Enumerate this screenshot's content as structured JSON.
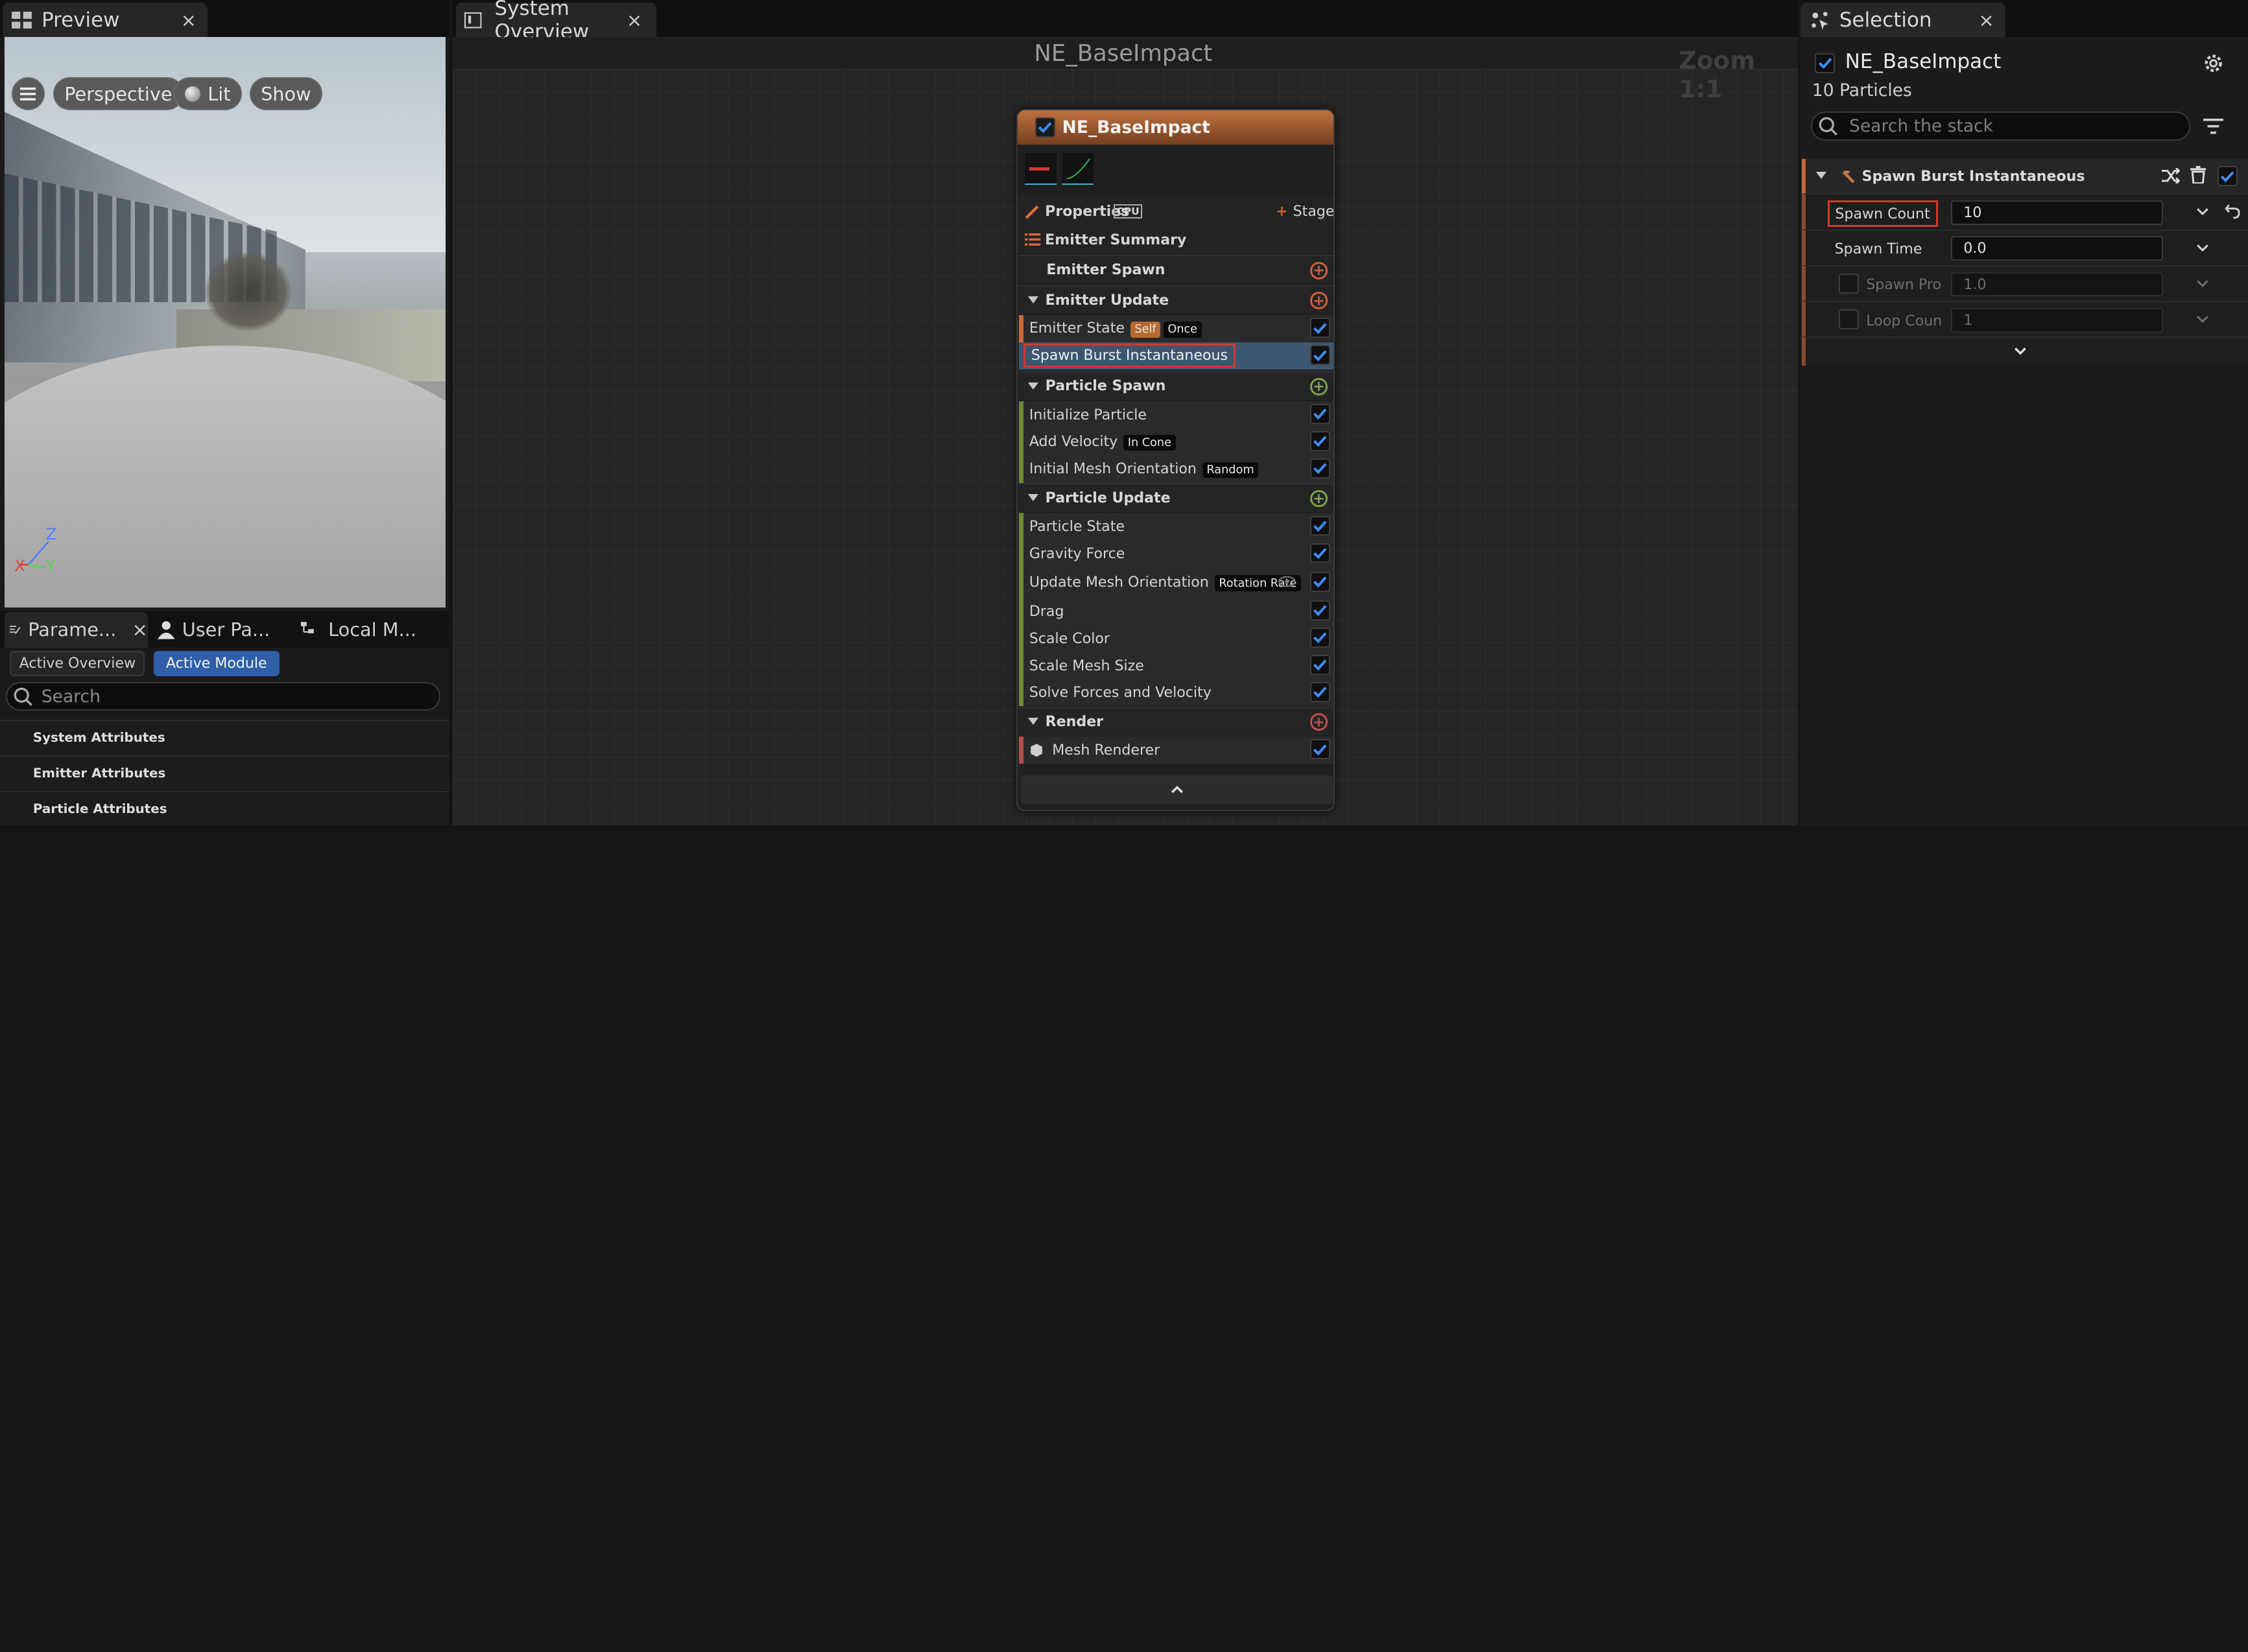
{
  "preview": {
    "tab_label": "Preview",
    "tab_close": "×",
    "buttons": {
      "perspective": "Perspective",
      "lit": "Lit",
      "show": "Show"
    },
    "axes": {
      "x": "X",
      "y": "Y",
      "z": "Z"
    }
  },
  "lower_left": {
    "tabs": [
      {
        "label": "Parame...",
        "close": "×"
      },
      {
        "label": "User Pa..."
      },
      {
        "label": "Local M..."
      }
    ],
    "pills": {
      "active_overview": "Active Overview",
      "active_module": "Active Module"
    },
    "search_placeholder": "Search",
    "attributes": [
      "System Attributes",
      "Emitter Attributes",
      "Particle Attributes"
    ]
  },
  "center": {
    "tab_label": "System Overview",
    "tab_close": "×",
    "title": "NE_BaseImpact",
    "zoom": "Zoom 1:1",
    "node": {
      "title": "NE_BaseImpact",
      "properties_label": "Properties",
      "cpu_label": "CPU",
      "stage_label": "Stage",
      "emitter_summary": "Emitter Summary",
      "emitter_spawn": "Emitter Spawn",
      "emitter_update": "Emitter Update",
      "emitter_state": {
        "label": "Emitter State",
        "tag1": "Self",
        "tag2": "Once"
      },
      "spawn_burst": "Spawn Burst Instantaneous",
      "particle_spawn": "Particle Spawn",
      "initialize_particle": "Initialize Particle",
      "add_velocity": {
        "label": "Add Velocity",
        "tag": "In Cone"
      },
      "initial_mesh": {
        "label": "Initial Mesh Orientation",
        "tag": "Random"
      },
      "particle_update": "Particle Update",
      "particle_state": "Particle State",
      "gravity_force": "Gravity Force",
      "update_mesh": {
        "label": "Update Mesh Orientation",
        "tag": "Rotation Rate"
      },
      "drag": "Drag",
      "scale_color": "Scale Color",
      "scale_mesh_size": "Scale Mesh Size",
      "solve_forces": "Solve Forces and Velocity",
      "render": "Render",
      "mesh_renderer": "Mesh Renderer"
    },
    "colors": {
      "node_header": "#b8693a",
      "spawn_accent": "#c7683d",
      "particle_accent": "#6f8a3a",
      "render_accent": "#b0514a",
      "selected_row": "#3d5670",
      "highlight_border": "#d0392b",
      "check": "#3f8cf0"
    }
  },
  "selection": {
    "tab_label": "Selection",
    "tab_close": "×",
    "emitter_name": "NE_BaseImpact",
    "particle_count": "10 Particles",
    "search_placeholder": "Search the stack",
    "module_title": "Spawn Burst Instantaneous",
    "props": [
      {
        "name": "Spawn Count",
        "value": "10"
      },
      {
        "name": "Spawn Time",
        "value": "0.0"
      },
      {
        "name": "Spawn Pro",
        "value": "1.0"
      },
      {
        "name": "Loop Coun",
        "value": "1"
      }
    ]
  }
}
